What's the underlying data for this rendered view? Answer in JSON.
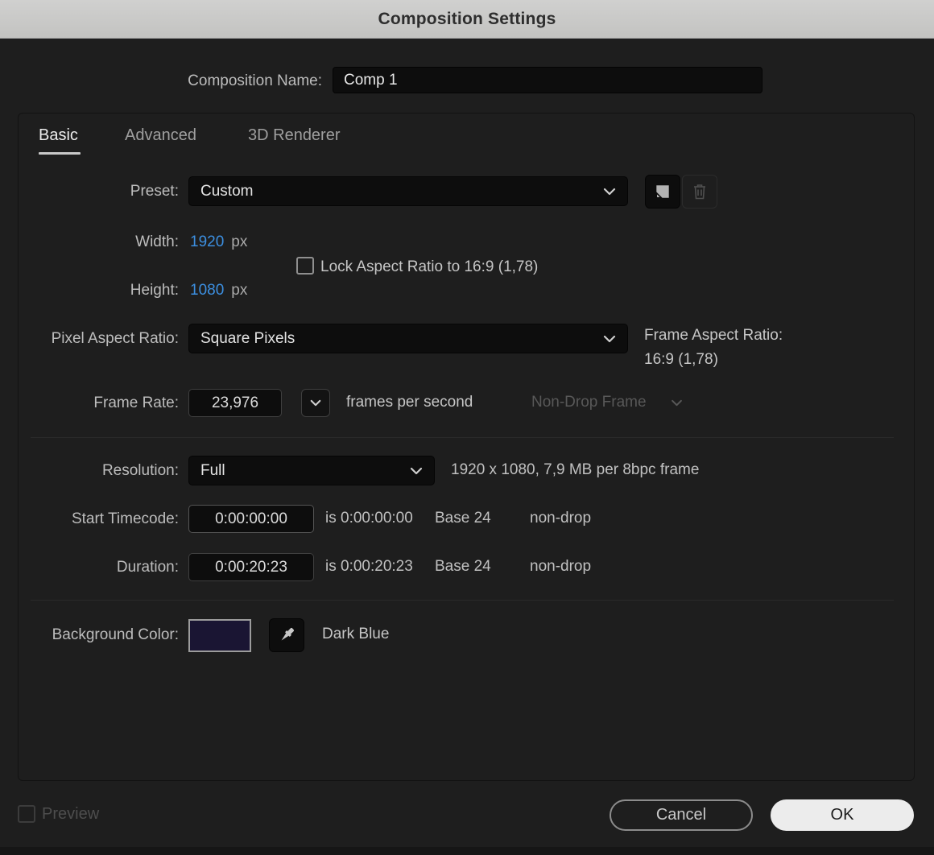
{
  "titlebar": {
    "title": "Composition Settings"
  },
  "composition_name": {
    "label": "Composition Name:",
    "value": "Comp 1"
  },
  "tabs": [
    {
      "label": "Basic",
      "active": true
    },
    {
      "label": "Advanced",
      "active": false
    },
    {
      "label": "3D Renderer",
      "active": false
    }
  ],
  "preset": {
    "label": "Preset:",
    "value": "Custom",
    "icons": [
      "save-preset-icon",
      "trash-icon"
    ]
  },
  "dimensions": {
    "width_label": "Width:",
    "width_value": "1920",
    "width_unit": "px",
    "height_label": "Height:",
    "height_value": "1080",
    "height_unit": "px",
    "lock_label": "Lock Aspect Ratio to 16:9 (1,78)",
    "lock_checked": false
  },
  "pixel_aspect_ratio": {
    "label": "Pixel Aspect Ratio:",
    "value": "Square Pixels",
    "frame_aspect_label": "Frame Aspect Ratio:",
    "frame_aspect_value": "16:9 (1,78)"
  },
  "frame_rate": {
    "label": "Frame Rate:",
    "value": "23,976",
    "unit": "frames per second",
    "drop_mode": "Non-Drop Frame",
    "drop_mode_enabled": false
  },
  "resolution": {
    "label": "Resolution:",
    "value": "Full",
    "info": "1920 x 1080, 7,9 MB per 8bpc frame"
  },
  "start_timecode": {
    "label": "Start Timecode:",
    "value": "0:00:00:00",
    "is_text": "is 0:00:00:00",
    "base_text": "Base 24",
    "drop_text": "non-drop"
  },
  "duration": {
    "label": "Duration:",
    "value": "0:00:20:23",
    "is_text": "is 0:00:20:23",
    "base_text": "Base 24",
    "drop_text": "non-drop"
  },
  "background_color": {
    "label": "Background Color:",
    "color_hex": "#1a1533",
    "color_name": "Dark Blue",
    "icon": "eyedropper-icon"
  },
  "footer": {
    "preview_label": "Preview",
    "preview_checked": false,
    "preview_enabled": false,
    "cancel_label": "Cancel",
    "ok_label": "OK"
  },
  "colors": {
    "titlebar_bg": "#c8c8c6",
    "dialog_bg": "#1e1e1e",
    "input_bg": "#0d0d0d",
    "accent_blue": "#3c8fe0",
    "swatch": "#1a1533",
    "ok_button_bg": "#ececec"
  }
}
